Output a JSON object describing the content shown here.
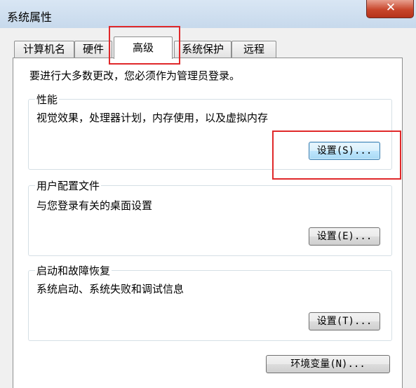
{
  "window": {
    "title": "系统属性",
    "close_glyph": "✕"
  },
  "tabs": [
    {
      "label": "计算机名",
      "active": false
    },
    {
      "label": "硬件",
      "active": false
    },
    {
      "label": "高级",
      "active": true
    },
    {
      "label": "系统保护",
      "active": false
    },
    {
      "label": "远程",
      "active": false
    }
  ],
  "advanced": {
    "intro": "要进行大多数更改，您必须作为管理员登录。",
    "performance": {
      "title": "性能",
      "description": "视觉效果，处理器计划，内存使用，以及虚拟内存",
      "button": "设置(S)..."
    },
    "user_profiles": {
      "title": "用户配置文件",
      "description": "与您登录有关的桌面设置",
      "button": "设置(E)..."
    },
    "startup_recovery": {
      "title": "启动和故障恢复",
      "description": "系统启动、系统失败和调试信息",
      "button": "设置(T)..."
    },
    "env_vars_button": "环境变量(N)..."
  },
  "colors": {
    "highlight": "#e0282a",
    "titlebar": "#c7d9ec",
    "close_button": "#c8462c"
  }
}
